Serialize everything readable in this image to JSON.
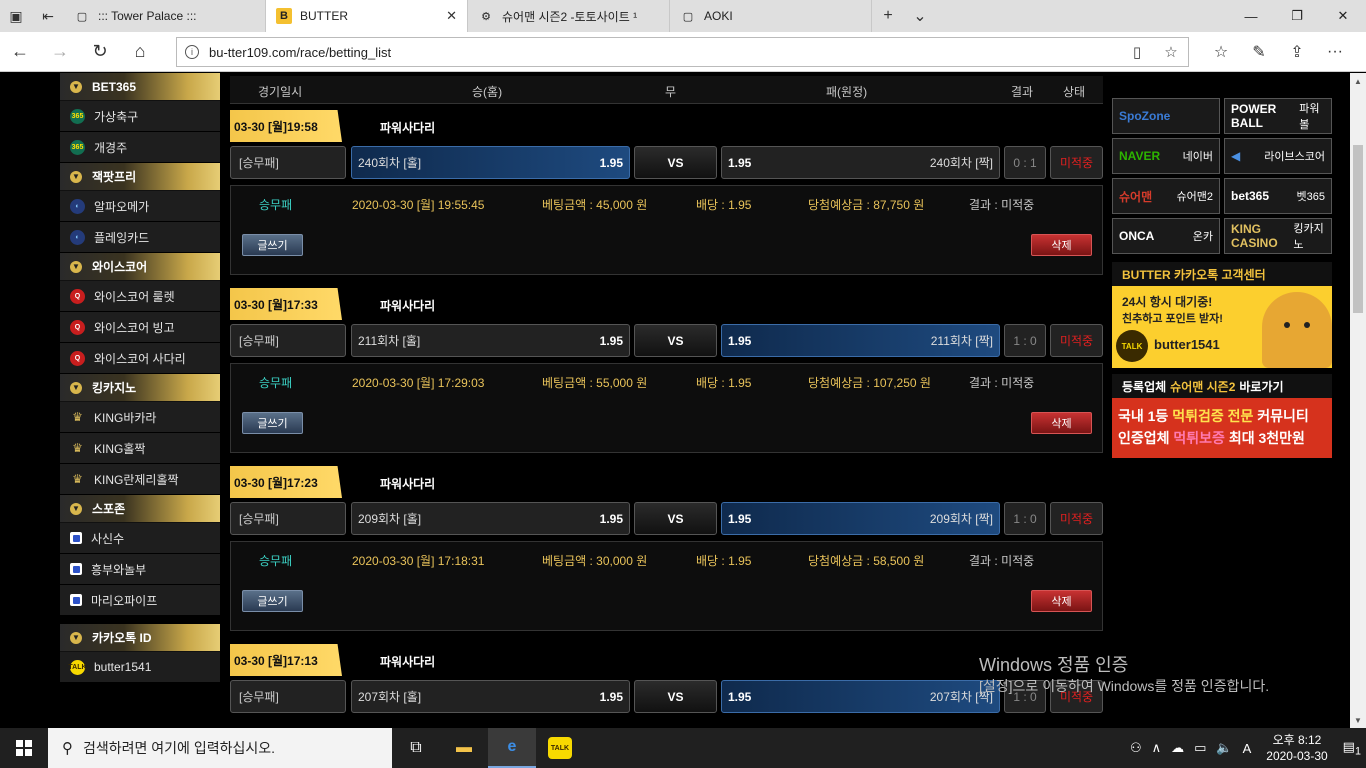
{
  "browser": {
    "tabs": [
      {
        "title": "::: Tower Palace :::",
        "active": false
      },
      {
        "title": "BUTTER",
        "active": true
      },
      {
        "title": "슈어맨 시즌2 -토토사이트 ¹",
        "active": false
      },
      {
        "title": "AOKI",
        "active": false
      }
    ],
    "url": "bu-tter109.com/race/betting_list"
  },
  "sidebar": {
    "groups": [
      {
        "title": "BET365",
        "items": [
          {
            "label": "가상축구",
            "icon": "bet365-icon"
          },
          {
            "label": "개경주",
            "icon": "bet365-icon"
          }
        ]
      },
      {
        "title": "잭팟프리",
        "items": [
          {
            "label": "알파오메가",
            "icon": "jackpot-icon"
          },
          {
            "label": "플레잉카드",
            "icon": "jackpot-icon"
          }
        ]
      },
      {
        "title": "와이스코어",
        "items": [
          {
            "label": "와이스코어 룰렛",
            "icon": "wisecore-icon"
          },
          {
            "label": "와이스코어 빙고",
            "icon": "wisecore-icon"
          },
          {
            "label": "와이스코어 사다리",
            "icon": "wisecore-icon"
          }
        ]
      },
      {
        "title": "킹카지노",
        "items": [
          {
            "label": "KING바카라",
            "icon": "king-icon"
          },
          {
            "label": "KING홀짝",
            "icon": "king-icon"
          },
          {
            "label": "KING란제리홀짝",
            "icon": "king-icon"
          }
        ]
      },
      {
        "title": "스포존",
        "items": [
          {
            "label": "사신수",
            "icon": "spozone-icon"
          },
          {
            "label": "흥부와놀부",
            "icon": "spozone-icon"
          },
          {
            "label": "마리오파이프",
            "icon": "spozone-icon"
          }
        ]
      }
    ],
    "kakao": {
      "title": "카카오톡 ID",
      "id": "butter1541"
    }
  },
  "columns": {
    "date": "경기일시",
    "home": "승(홈)",
    "draw": "무",
    "away": "패(원정)",
    "result": "결과",
    "status": "상태"
  },
  "bets": [
    {
      "date": "03-30 [월]19:58",
      "game": "파워사다리",
      "type": "[승무패]",
      "home": "240회차 [홀]",
      "home_odds": "1.95",
      "vs": "VS",
      "away_odds": "1.95",
      "away": "240회차 [짝]",
      "score": "0 : 1",
      "status": "미적중",
      "selected": "home",
      "d_type": "승무패",
      "d_time": "2020-03-30 [월] 19:55:45",
      "d_amount": "베팅금액 : 45,000 원",
      "d_odds": "배당 : 1.95",
      "d_win": "당첨예상금 : 87,750 원",
      "d_result": "결과 : 미적중",
      "write": "글쓰기",
      "delete": "삭제"
    },
    {
      "date": "03-30 [월]17:33",
      "game": "파워사다리",
      "type": "[승무패]",
      "home": "211회차 [홀]",
      "home_odds": "1.95",
      "vs": "VS",
      "away_odds": "1.95",
      "away": "211회차 [짝]",
      "score": "1 : 0",
      "status": "미적중",
      "selected": "away",
      "d_type": "승무패",
      "d_time": "2020-03-30 [월] 17:29:03",
      "d_amount": "베팅금액 : 55,000 원",
      "d_odds": "배당 : 1.95",
      "d_win": "당첨예상금 : 107,250 원",
      "d_result": "결과 : 미적중",
      "write": "글쓰기",
      "delete": "삭제"
    },
    {
      "date": "03-30 [월]17:23",
      "game": "파워사다리",
      "type": "[승무패]",
      "home": "209회차 [홀]",
      "home_odds": "1.95",
      "vs": "VS",
      "away_odds": "1.95",
      "away": "209회차 [짝]",
      "score": "1 : 0",
      "status": "미적중",
      "selected": "away",
      "d_type": "승무패",
      "d_time": "2020-03-30 [월] 17:18:31",
      "d_amount": "베팅금액 : 30,000 원",
      "d_odds": "배당 : 1.95",
      "d_win": "당첨예상금 : 58,500 원",
      "d_result": "결과 : 미적중",
      "write": "글쓰기",
      "delete": "삭제"
    },
    {
      "date": "03-30 [월]17:13",
      "game": "파워사다리",
      "type": "[승무패]",
      "home": "207회차 [홀]",
      "home_odds": "1.95",
      "vs": "VS",
      "away_odds": "1.95",
      "away": "207회차 [짝]",
      "score": "1 : 0",
      "status": "미적중",
      "selected": "away"
    }
  ],
  "partners": [
    {
      "logo": "SpoZone",
      "label": "",
      "color": "#3a7bd5"
    },
    {
      "logo": "POWER BALL",
      "label": "파워볼",
      "color": "#ffffff"
    },
    {
      "logo": "NAVER",
      "label": "네이버",
      "color": "#2db400"
    },
    {
      "logo": "◀",
      "label": "라이브스코어",
      "color": "#4a90e2"
    },
    {
      "logo": "슈어맨",
      "label": "슈어맨2",
      "color": "#d63b2b"
    },
    {
      "logo": "bet365",
      "label": "벳365",
      "color": "#ffffff"
    },
    {
      "logo": "ONCA",
      "label": "온카",
      "color": "#ffffff"
    },
    {
      "logo": "KING CASINO",
      "label": "킹카지노",
      "color": "#e0c060"
    }
  ],
  "kakao_ad": {
    "header": "BUTTER 카카오톡 고객센터",
    "line1": "24시 항시 대기중!",
    "line2": "친추하고 포인트 받자!",
    "talk": "TALK",
    "id": "butter1541"
  },
  "reg_ad": {
    "header_pre": "등록업체",
    "header_hl": "슈어맨 시즌2",
    "header_post": "바로가기",
    "r1a": "국내 1등",
    "r1b": "먹튀검증 전문",
    "r1c": "커뮤니티",
    "r2a": "인증업체",
    "r2b": "먹튀보증",
    "r2c": "최대 3천만원"
  },
  "watermark": {
    "line1": "Windows 정품 인증",
    "line2": "[설정]으로 이동하여 Windows를 정품 인증합니다."
  },
  "taskbar": {
    "search": "검색하려면 여기에 입력하십시오.",
    "time": "오후 8:12",
    "date": "2020-03-30",
    "notif": "1"
  }
}
